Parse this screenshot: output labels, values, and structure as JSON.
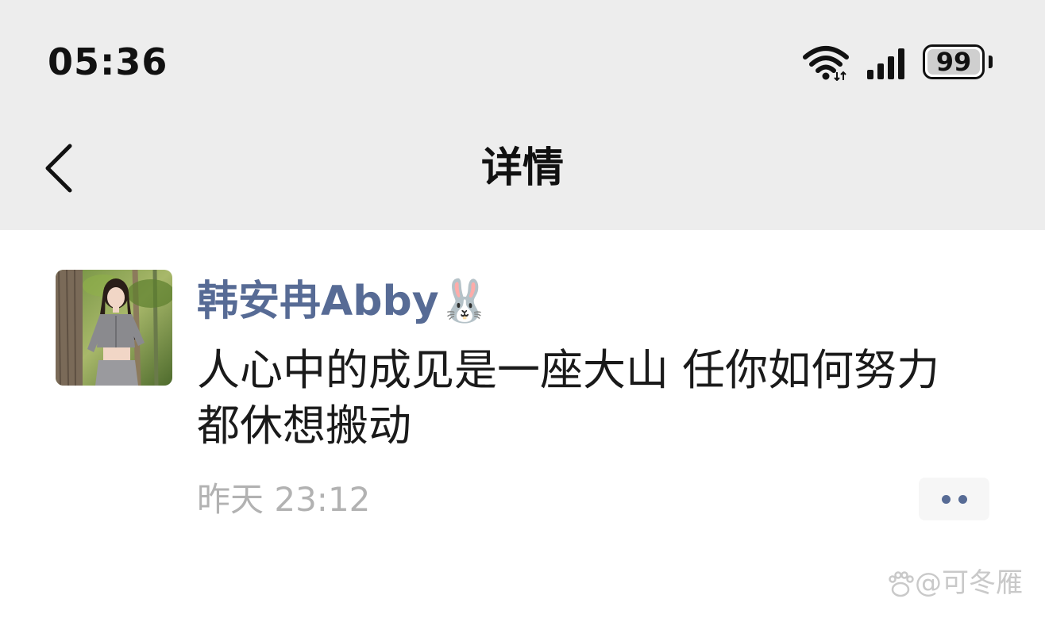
{
  "status_bar": {
    "time": "05:36",
    "battery": "99",
    "icons": [
      "wifi-icon",
      "signal-icon",
      "battery-icon"
    ]
  },
  "nav": {
    "back_icon": "chevron-left-icon",
    "title": "详情"
  },
  "post": {
    "author": "韩安冉Abby",
    "author_emoji": "🐰",
    "text": "人心中的成见是一座大山 任你如何努力都休想搬动",
    "time": "昨天 23:12",
    "more_icon": "more-dots-icon"
  },
  "watermark": {
    "text": "@可冬雁",
    "logo_icon": "paw-logo-icon"
  },
  "colors": {
    "header_bg": "#ededed",
    "link": "#576b95",
    "text": "#1a1a1a",
    "muted": "#b2b2b2"
  }
}
